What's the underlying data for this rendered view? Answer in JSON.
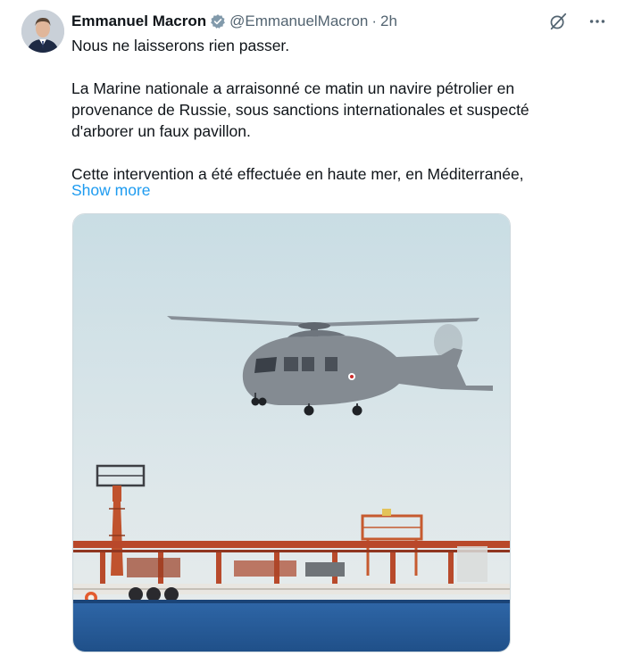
{
  "tweet": {
    "author_name": "Emmanuel Macron",
    "author_handle": "@EmmanuelMacron",
    "separator": "·",
    "time": "2h",
    "paragraphs": [
      "Nous ne laisserons rien passer.",
      "La Marine nationale a arraisonné ce matin un navire pétrolier en provenance de Russie, sous sanctions internationales et suspecté d'arborer un faux pavillon.",
      "Cette intervention a été effectuée en haute mer, en Méditerranée,"
    ],
    "show_more": "Show more",
    "icons": {
      "verified": "verified-badge-icon",
      "grok": "grok-icon",
      "more": "more-icon"
    },
    "colors": {
      "link": "#1d9bf0",
      "secondary_text": "#536471",
      "verified": "#829aab"
    }
  }
}
